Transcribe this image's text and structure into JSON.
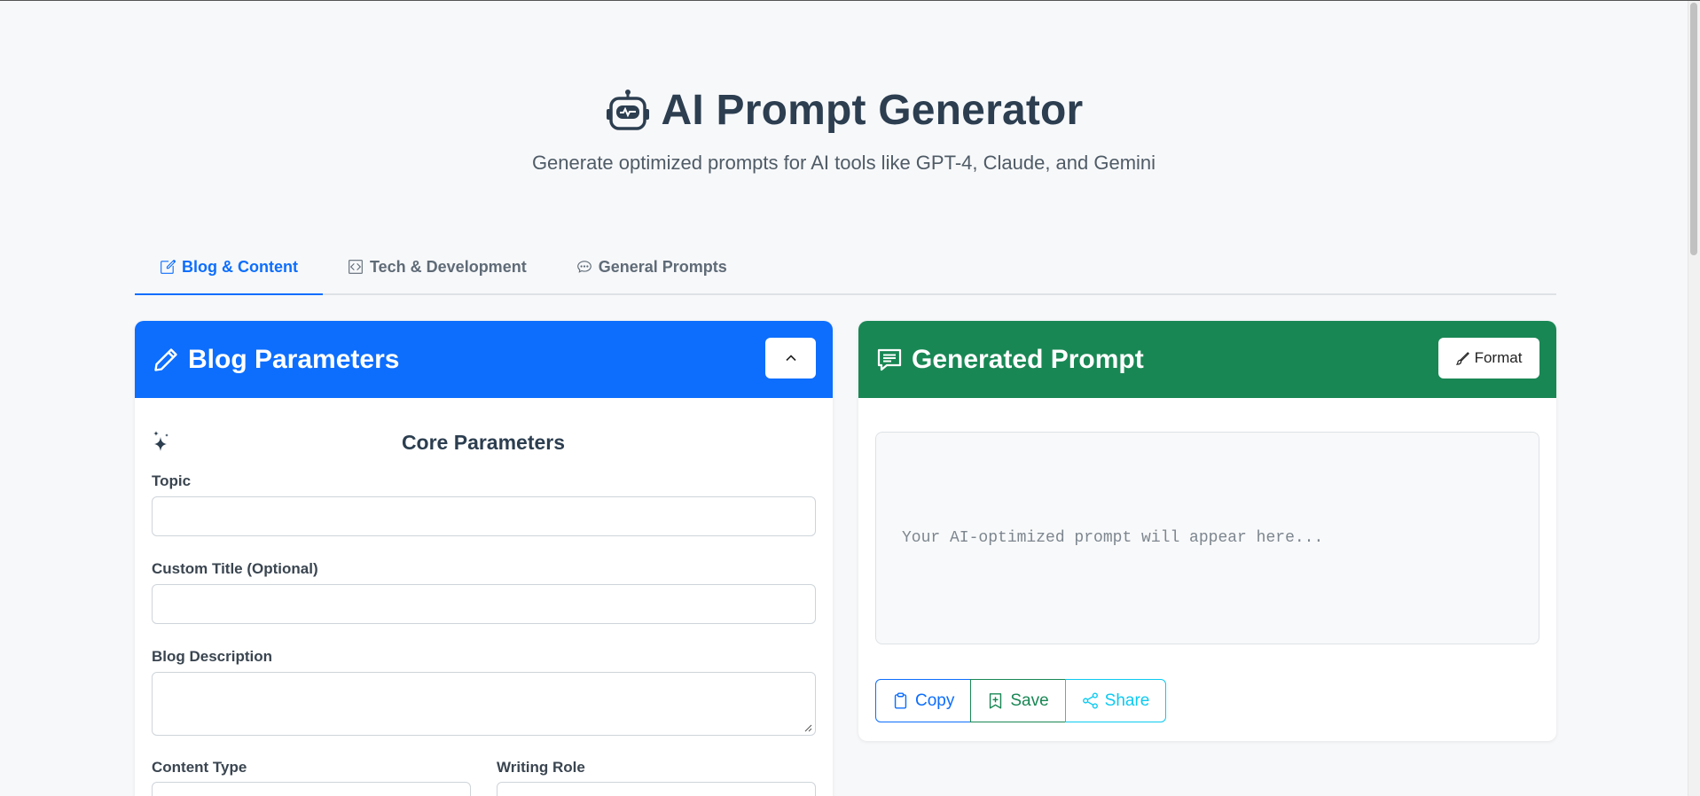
{
  "header": {
    "title": "AI Prompt Generator",
    "subtitle": "Generate optimized prompts for AI tools like GPT-4, Claude, and Gemini",
    "icon": "robot-icon"
  },
  "tabs": [
    {
      "label": "Blog & Content",
      "icon": "pencil-square-icon",
      "active": true
    },
    {
      "label": "Tech & Development",
      "icon": "code-square-icon",
      "active": false
    },
    {
      "label": "General Prompts",
      "icon": "chat-dots-icon",
      "active": false
    }
  ],
  "left_panel": {
    "title": "Blog Parameters",
    "section_title": "Core Parameters",
    "fields": {
      "topic": {
        "label": "Topic",
        "value": ""
      },
      "custom_title": {
        "label": "Custom Title (Optional)",
        "value": ""
      },
      "blog_description": {
        "label": "Blog Description",
        "value": ""
      },
      "content_type": {
        "label": "Content Type"
      },
      "writing_role": {
        "label": "Writing Role"
      }
    }
  },
  "right_panel": {
    "title": "Generated Prompt",
    "format_label": "Format",
    "placeholder": "Your AI-optimized prompt will appear here...",
    "actions": {
      "copy": "Copy",
      "save": "Save",
      "share": "Share"
    }
  },
  "colors": {
    "primary": "#0d6efd",
    "success": "#198754",
    "info": "#0dcaf0",
    "text": "#2c3e50"
  }
}
